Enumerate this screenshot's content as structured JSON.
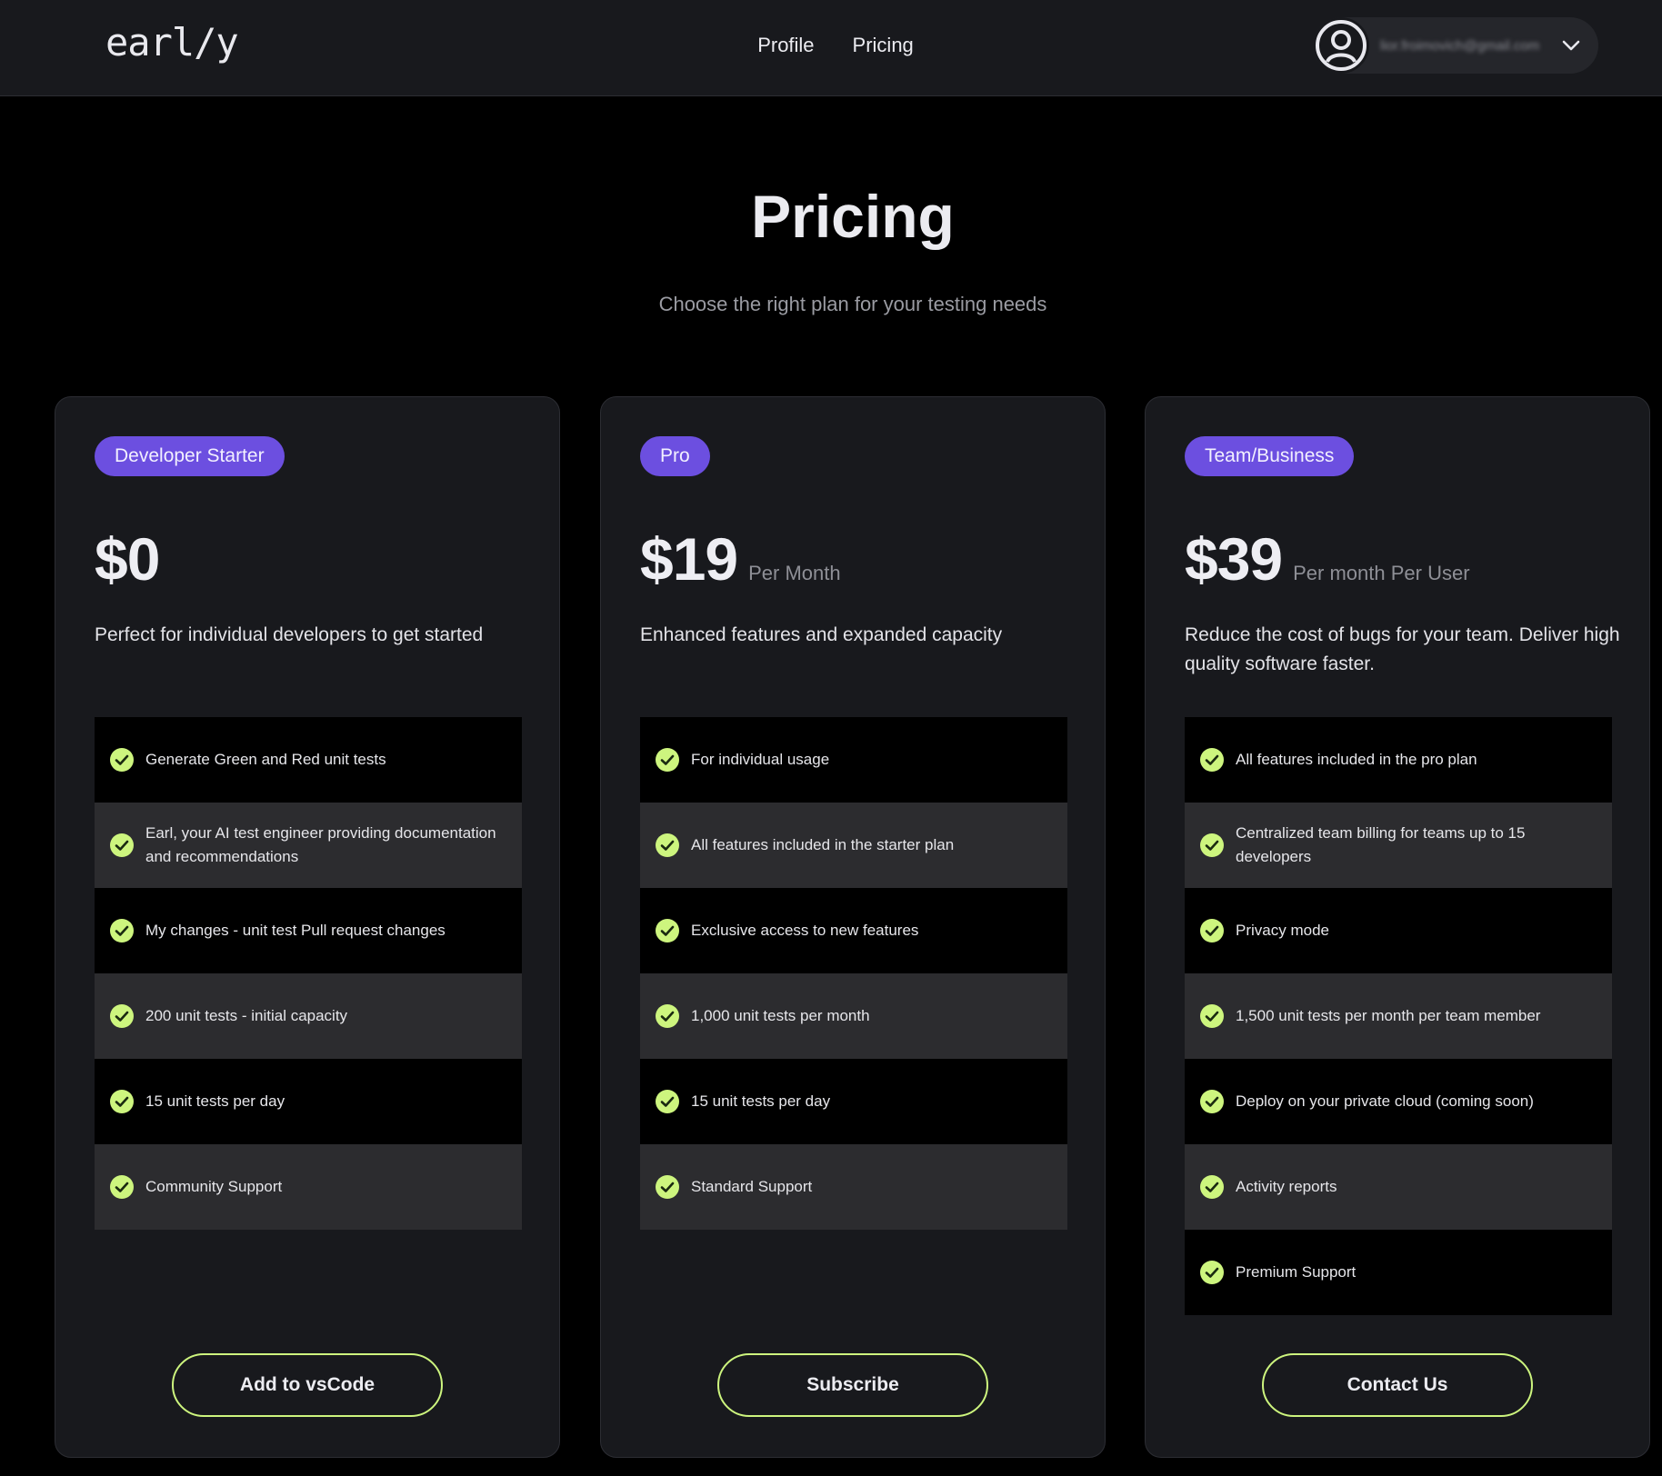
{
  "header": {
    "logo": "earl/y",
    "nav": [
      {
        "label": "Profile"
      },
      {
        "label": "Pricing"
      }
    ],
    "user": {
      "email": "lior.froimovich@gmail.com",
      "avatar_icon": "user-circle-icon",
      "chevron_icon": "chevron-down-icon"
    }
  },
  "hero": {
    "title": "Pricing",
    "subtitle": "Choose the right plan for your testing needs"
  },
  "colors": {
    "accent_purple": "#6c4fe0",
    "accent_green": "#cdf57e",
    "card_bg": "#18191d",
    "page_bg": "#000000"
  },
  "plans": [
    {
      "badge": "Developer Starter",
      "price": "$0",
      "period": "",
      "description": "Perfect for individual developers to get started",
      "features": [
        "Generate Green and Red unit tests",
        "Earl, your AI test engineer providing documentation and recommendations",
        "My changes - unit test Pull request changes",
        "200 unit tests - initial capacity",
        "15 unit tests per day",
        "Community Support"
      ],
      "cta": "Add to vsCode"
    },
    {
      "badge": "Pro",
      "price": "$19",
      "period": "Per Month",
      "description": "Enhanced features and expanded capacity",
      "features": [
        "For individual usage",
        "All features included in the starter plan",
        "Exclusive access to new features",
        "1,000 unit tests per month",
        "15 unit tests per day",
        "Standard Support"
      ],
      "cta": "Subscribe"
    },
    {
      "badge": "Team/Business",
      "price": "$39",
      "period": "Per month Per User",
      "description": "Reduce the cost of bugs for your team. Deliver high quality software faster.",
      "features": [
        "All features included in the pro plan",
        "Centralized team billing for teams up to 15 developers",
        "Privacy mode",
        "1,500 unit tests per month per team member",
        "Deploy on your private cloud (coming soon)",
        "Activity reports",
        "Premium Support"
      ],
      "cta": "Contact Us"
    }
  ]
}
